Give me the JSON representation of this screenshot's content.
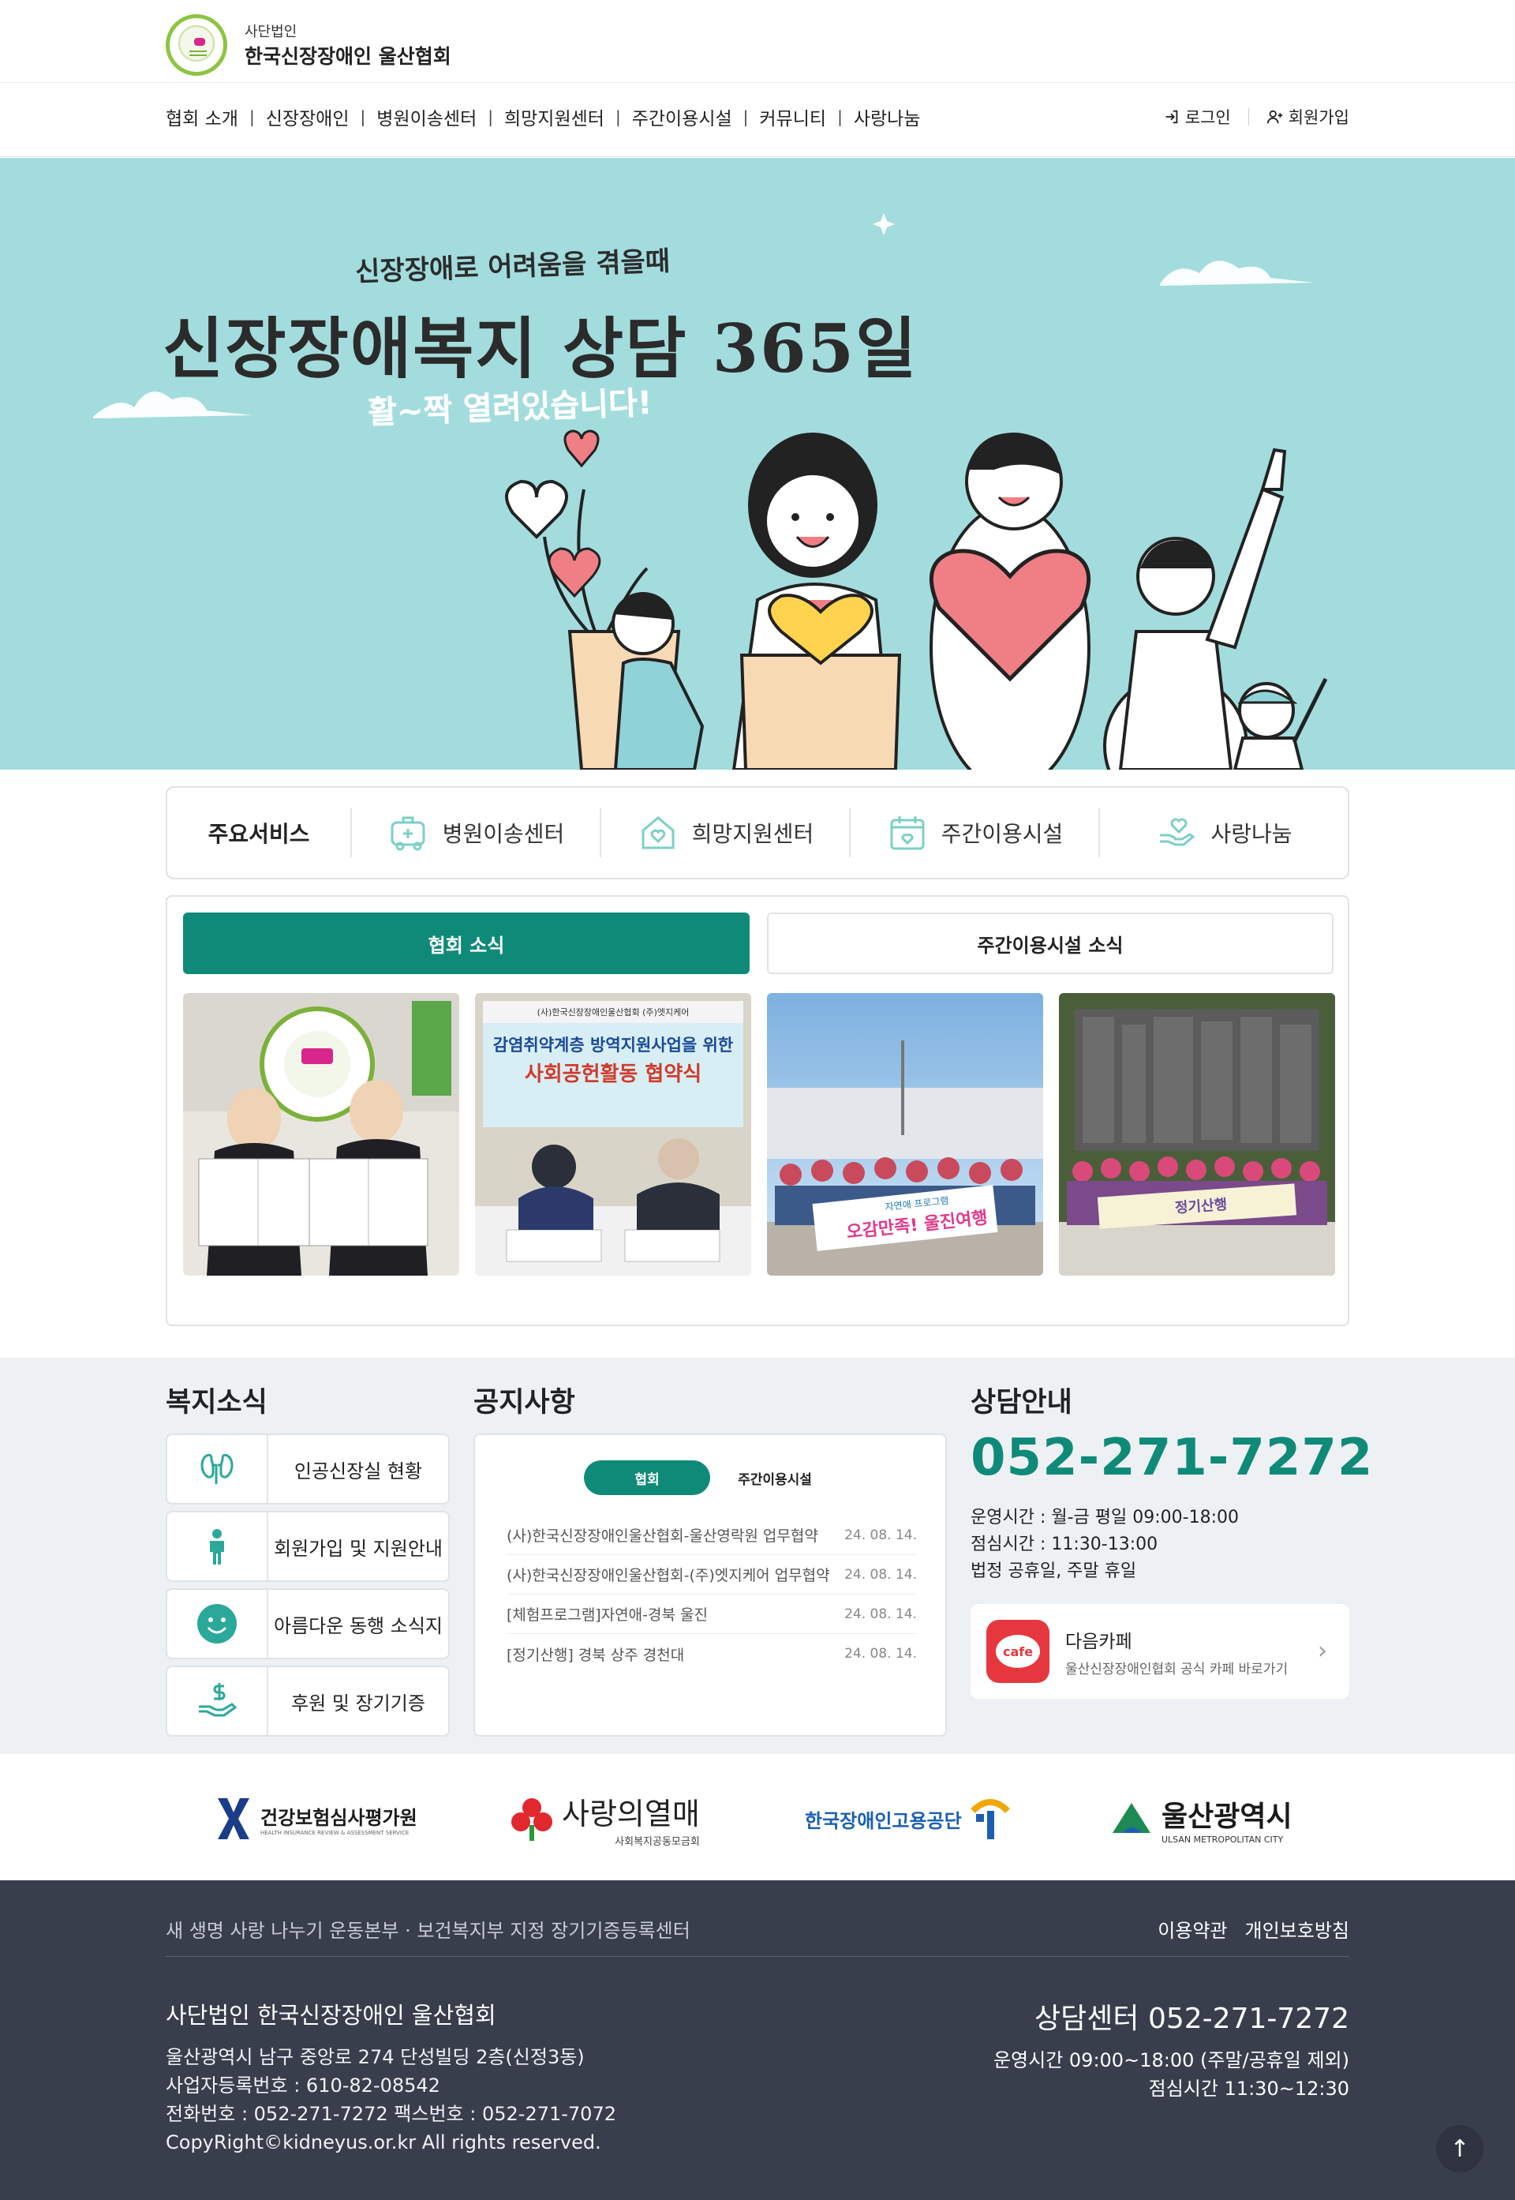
{
  "header": {
    "org_prefix": "사단법인",
    "org_name": "한국신장장애인 울산협회",
    "nav": [
      "협회 소개",
      "신장장애인",
      "병원이송센터",
      "희망지원센터",
      "주간이용시설",
      "커뮤니티",
      "사랑나눔"
    ],
    "login": "로그인",
    "signup": "회원가입"
  },
  "hero": {
    "subtitle": "신장장애로 어려움을 겪을때",
    "title": "신장장애복지 상담 365일",
    "tagline": "활~짝 열려있습니다!"
  },
  "services": {
    "title": "주요서비스",
    "items": [
      {
        "label": "병원이송센터",
        "icon": "ambulance-icon"
      },
      {
        "label": "희망지원센터",
        "icon": "heart-house-icon"
      },
      {
        "label": "주간이용시설",
        "icon": "calendar-icon"
      },
      {
        "label": "사랑나눔",
        "icon": "heart-hand-icon"
      }
    ]
  },
  "news": {
    "tabs": [
      "협회 소식",
      "주간이용시설 소식"
    ],
    "photos": [
      {
        "banner": ""
      },
      {
        "banner_org": "(사)한국신장장애인울산협회   (주)엣지케어",
        "banner_title1": "감염취약계층 방역지원사업을 위한",
        "banner_title2": "사회공헌활동 협약식"
      },
      {
        "banner_org": "자연애 프로그램",
        "banner_title1": "오감만족! 울진여행"
      },
      {
        "banner_org": "",
        "banner_title1": "정기산행"
      }
    ]
  },
  "welfare": {
    "title": "복지소식",
    "items": [
      {
        "label": "인공신장실 현황",
        "icon": "kidney-icon"
      },
      {
        "label": "회원가입 및 지원안내",
        "icon": "person-icon"
      },
      {
        "label": "아름다운 동행 소식지",
        "icon": "smile-icon"
      },
      {
        "label": "후원 및 장기기증",
        "icon": "donation-icon"
      }
    ]
  },
  "notice": {
    "title": "공지사항",
    "tabs": [
      "협회",
      "주간이용시설"
    ],
    "rows": [
      {
        "text": "(사)한국신장장애인울산협회-울산영락원 업무협약",
        "date": "24. 08. 14."
      },
      {
        "text": "(사)한국신장장애인울산협회-(주)엣지케어 업무협약",
        "date": "24. 08. 14."
      },
      {
        "text": "[체험프로그램]자연애-경북 울진",
        "date": "24. 08. 14."
      },
      {
        "text": "[정기산행] 경북 상주 경천대",
        "date": "24. 08. 14."
      }
    ]
  },
  "consult": {
    "title": "상담안내",
    "phone": "052-271-7272",
    "hours1": "운영시간 : 월-금 평일 09:00-18:00",
    "hours2": "점심시간 : 11:30-13:00",
    "hours3": "법정 공휴일, 주말 휴일",
    "cafe_icon_text": "cafe",
    "cafe_title": "다음카페",
    "cafe_desc": "울산신장장애인협회 공식 카페 바로가기"
  },
  "partners": [
    {
      "name": "건강보험심사평가원",
      "sub": "HEALTH INSURANCE REVIEW & ASSESSMENT SERVICE"
    },
    {
      "name": "사랑의열매",
      "sub": "사회복지공동모금회"
    },
    {
      "name": "한국장애인고용공단",
      "sub": ""
    },
    {
      "name": "울산광역시",
      "sub": "ULSAN METROPOLITAN CITY"
    }
  ],
  "footer": {
    "tagline": "새 생명 사랑 나누기 운동본부 · 보건복지부 지정 장기기증등록센터",
    "links": [
      "이용약관",
      "개인보호방침"
    ],
    "org": "사단법인  한국신장장애인 울산협회",
    "address": "울산광역시 남구 중앙로 274 단성빌딩 2층(신정3동)",
    "bizno": "사업자등록번호 : 610-82-08542",
    "tel": "전화번호 : 052-271-7272 팩스번호 : 052-271-7072",
    "copyright": "CopyRight©kidneyus.or.kr All rights reserved.",
    "call": "상담센터 052-271-7272",
    "hours1": "운영시간 09:00~18:00 (주말/공휴일 제외)",
    "hours2": "점심시간 11:30~12:30",
    "top_button": "↑"
  },
  "colors": {
    "accent": "#0f8a79",
    "hero_bg": "#a3dcdd",
    "footer_bg": "#383e4c"
  }
}
